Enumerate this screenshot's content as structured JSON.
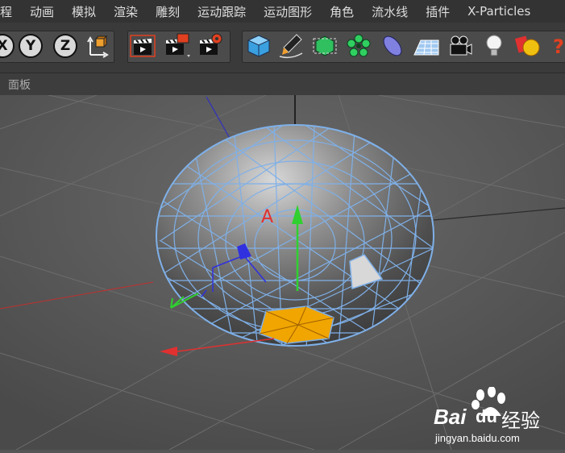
{
  "menu": {
    "items": [
      "程",
      "动画",
      "模拟",
      "渲染",
      "雕刻",
      "运动跟踪",
      "运动图形",
      "角色",
      "流水线",
      "插件",
      "X-Particles"
    ]
  },
  "toolbar": {
    "axis_x": "X",
    "axis_y": "Y",
    "axis_z": "Z"
  },
  "panel": {
    "label": "面板"
  },
  "viewport": {
    "gizmo_label": "A"
  },
  "watermark": {
    "brand": "Bai",
    "brand2": "du",
    "suffix": "经验",
    "url": "jingyan.baidu.com"
  },
  "colors": {
    "menubar_bg": "#333333",
    "toolbar_bg": "#3a3a3a",
    "viewport_bg": "#565656",
    "mesh_edge": "#7fb0e8",
    "selected_poly": "#f0a500",
    "axis_x": "#e03030",
    "axis_y": "#30d030",
    "axis_z": "#3030e0"
  }
}
